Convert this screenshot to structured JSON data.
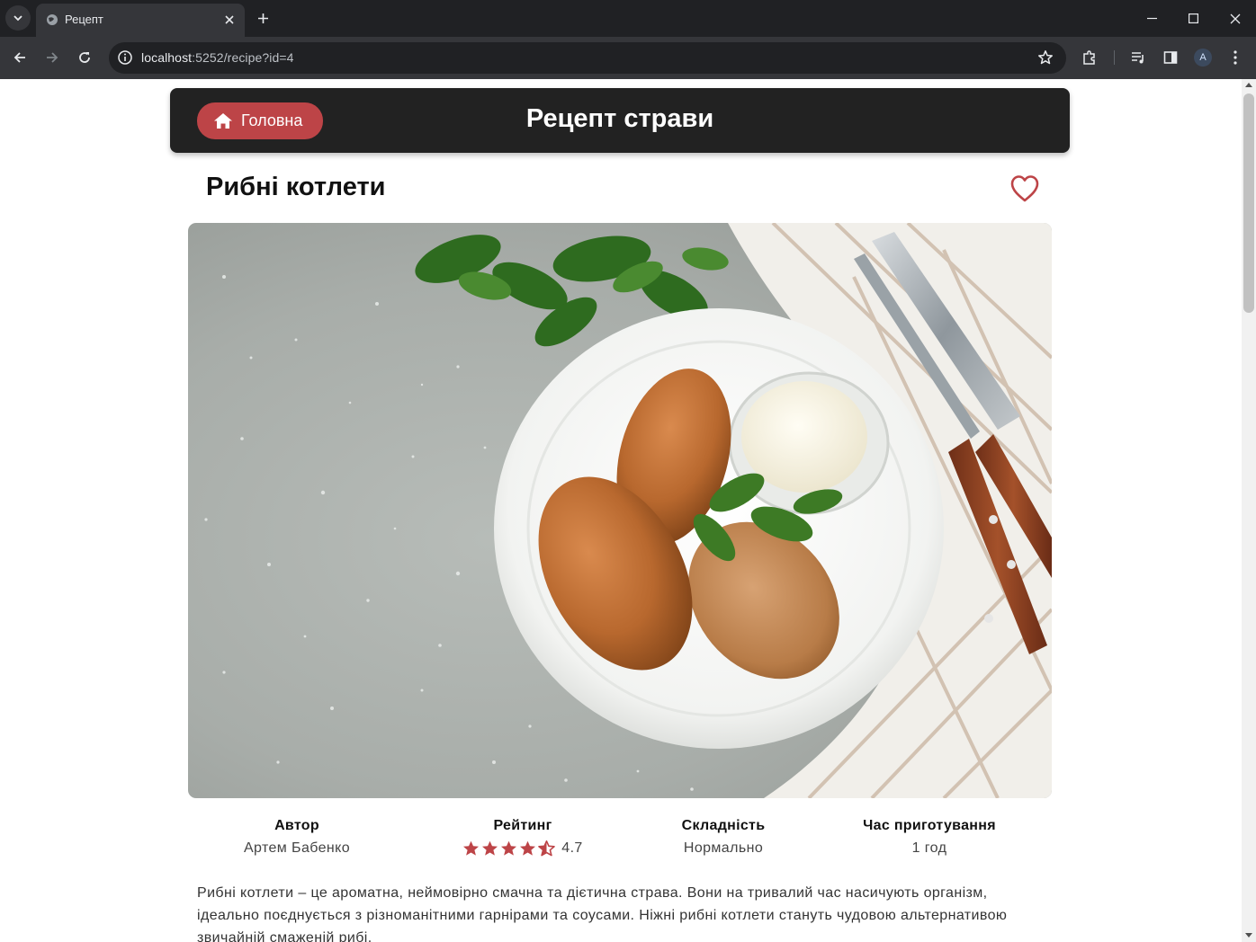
{
  "browser": {
    "tab_title": "Рецепт",
    "url_host": "localhost",
    "url_rest": ":5252/recipe?id=4",
    "avatar_letter": "A"
  },
  "header": {
    "home_label": "Головна",
    "title": "Рецепт страви"
  },
  "recipe": {
    "title": "Рибні котлети",
    "image_alt": "Рибні котлети",
    "favorite": false,
    "meta": {
      "author_label": "Автор",
      "author": "Артем Бабенко",
      "rating_label": "Рейтинг",
      "rating": "4.7",
      "difficulty_label": "Складність",
      "difficulty": "Нормально",
      "time_label": "Час приготування",
      "time": "1 год"
    },
    "description": "Рибні котлети – це ароматна, неймовірно смачна та дієтична страва. Вони на тривалий час насичують організм, ідеально поєднується з різноманітними гарнірами та соусами. Ніжні рибні котлети стануть чудовою альтернативою звичайній смаженій рибі."
  },
  "colors": {
    "accent": "#bd4447",
    "header_bg": "#222222",
    "browser_dark": "#202124"
  },
  "icons": {
    "home": "home-icon",
    "favorite": "heart-outline-icon",
    "star_full": "star-icon",
    "star_half": "star-half-icon"
  }
}
